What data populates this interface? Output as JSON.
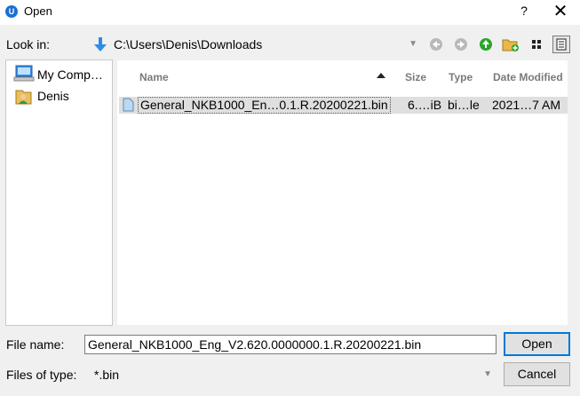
{
  "window": {
    "title": "Open",
    "help_label": "?",
    "close_label": "✕"
  },
  "lookin": {
    "label": "Look in:",
    "path": "C:\\Users\\Denis\\Downloads"
  },
  "sidebar": {
    "items": [
      {
        "label": "My Comp…",
        "icon": "computer-icon"
      },
      {
        "label": "Denis",
        "icon": "user-folder-icon"
      }
    ]
  },
  "filelist": {
    "columns": [
      "Name",
      "Size",
      "Type",
      "Date Modified"
    ],
    "sort_column": "Name",
    "rows": [
      {
        "name": "General_NKB1000_En…0.1.R.20200221.bin",
        "size": "6.…iB",
        "type": "bi…le",
        "date": "2021…7 AM",
        "selected": true
      }
    ]
  },
  "filename": {
    "label": "File name:",
    "value": "General_NKB1000_Eng_V2.620.0000000.1.R.20200221.bin"
  },
  "filetype": {
    "label": "Files of type:",
    "value": "*.bin"
  },
  "buttons": {
    "open": "Open",
    "cancel": "Cancel"
  },
  "colors": {
    "accent": "#0078d7",
    "selection": "#dfdfdf",
    "header_text": "#7a7a7a"
  }
}
